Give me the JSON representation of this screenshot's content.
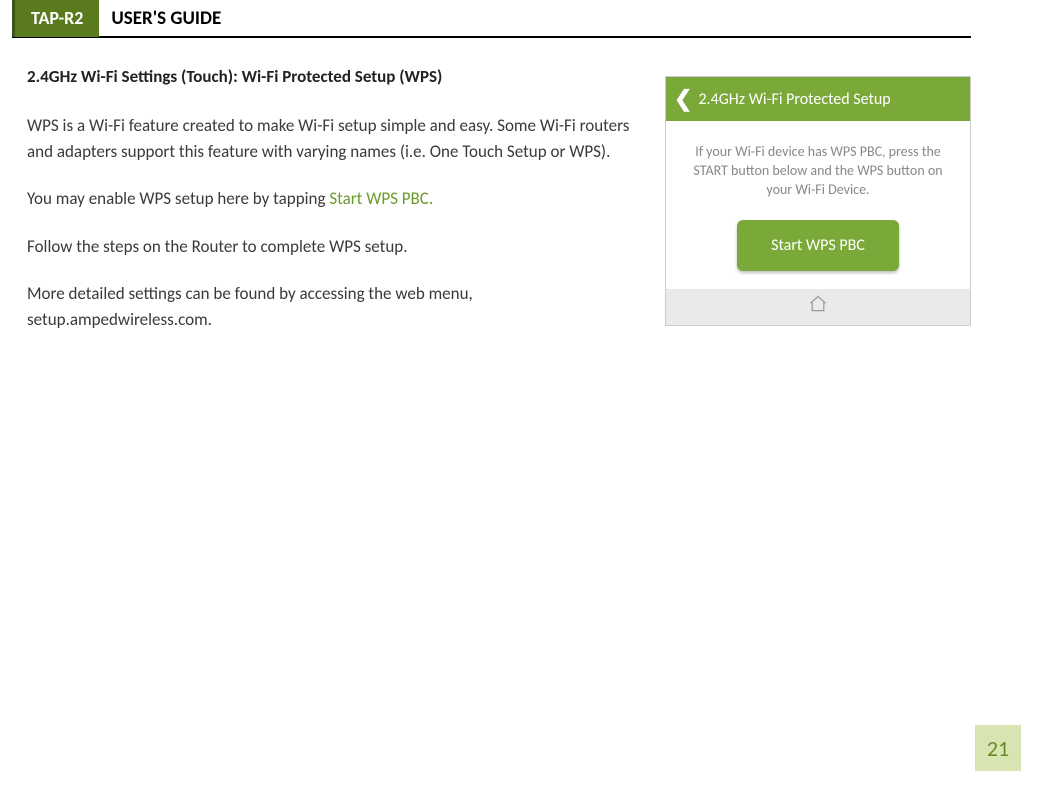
{
  "header": {
    "badge": "TAP-R2",
    "title": "USER'S GUIDE"
  },
  "section_heading": "2.4GHz Wi-Fi Settings (Touch): Wi-Fi Protected Setup (WPS)",
  "paragraphs": {
    "p1": "WPS is a Wi-Fi feature created to make Wi-Fi setup simple and easy.  Some Wi-Fi routers and adapters support this feature with varying names (i.e. One Touch Setup or WPS).",
    "p2_pre": "You may enable WPS setup here by tapping ",
    "p2_link": "Start WPS PBC.",
    "p3": "Follow the steps on the Router to complete WPS setup.",
    "p4": "More detailed settings can be found by accessing the web menu, setup.ampedwireless.com."
  },
  "device_panel": {
    "title": "2.4GHz Wi-Fi Protected Setup",
    "instruction": "If your Wi-Fi device has WPS PBC, press the START button below and the WPS button on your Wi-Fi Device.",
    "button_label": "Start WPS PBC"
  },
  "page_number": "21"
}
